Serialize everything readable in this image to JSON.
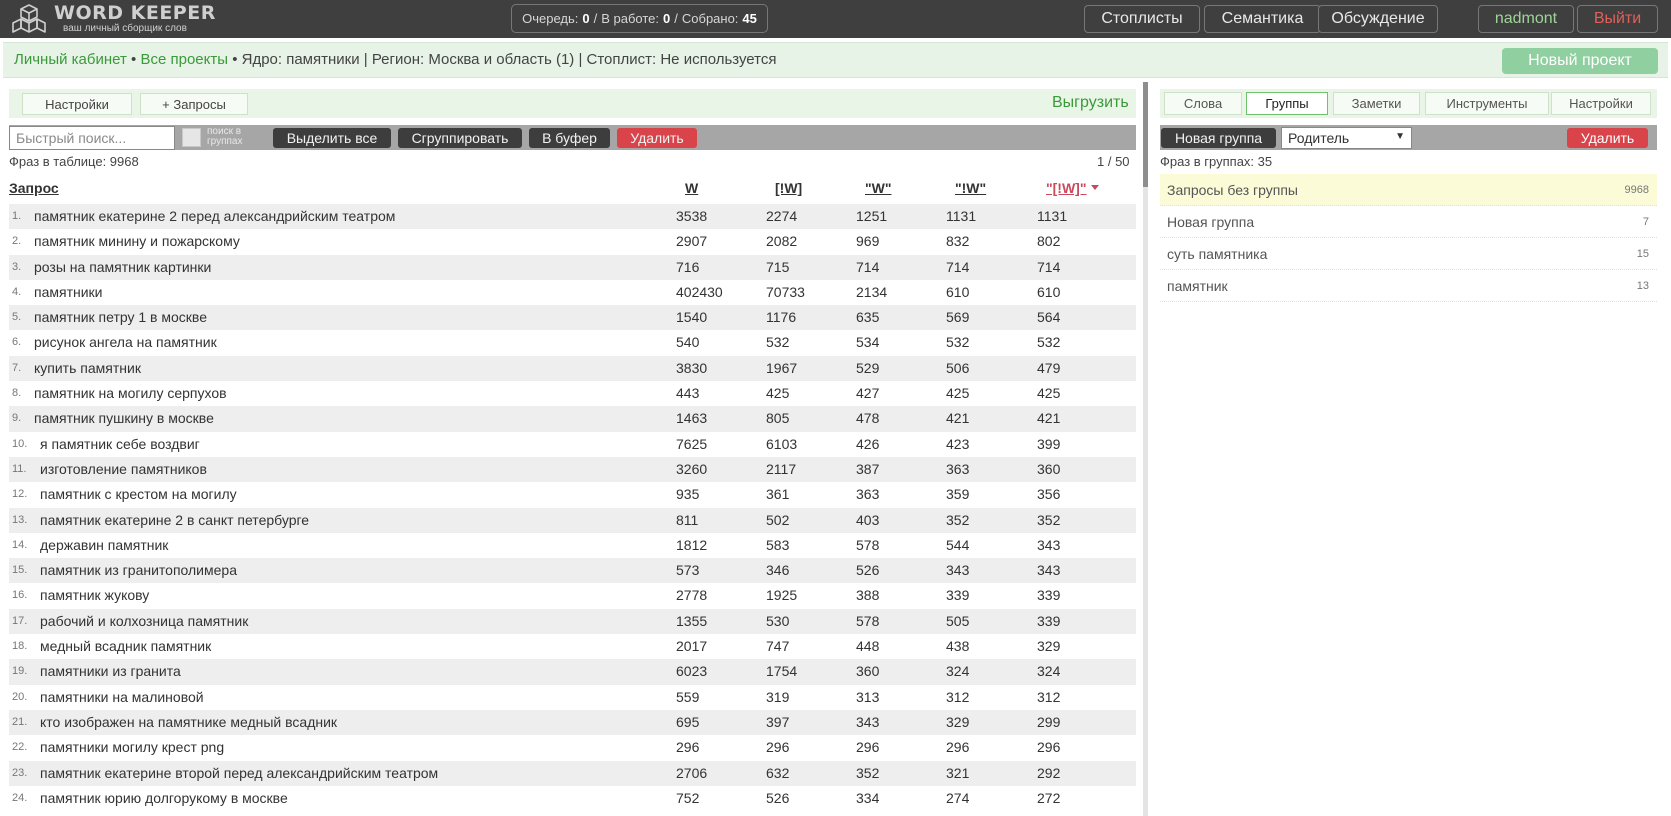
{
  "app": {
    "title": "WORD KEEPER",
    "subtitle": "ваш личный сборщик слов"
  },
  "queue": {
    "queue_label": "Очередь:",
    "queue_value": "0",
    "sep1": "/",
    "work_label": "В работе:",
    "work_value": "0",
    "sep2": "/",
    "collected_label": "Собрано:",
    "collected_value": "45"
  },
  "nav": {
    "stoplists": "Стоплисты",
    "semantics": "Семантика",
    "discussion": "Обсуждение",
    "user": "nadmont",
    "logout": "Выйти"
  },
  "breadcrumb": {
    "cabinet": "Личный кабинет",
    "dot1": "•",
    "projects": "Все проекты",
    "rest": "• Ядро: памятники | Регион: Москва и область (1) | Стоплист: Не используется"
  },
  "new_project": "Новый проект",
  "left": {
    "settings": "Настройки",
    "add_queries": "+ Запросы",
    "export": "Выгрузить",
    "search_placeholder": "Быстрый поиск...",
    "search_in_groups": "поиск в группах",
    "select_all": "Выделить все",
    "group": "Сгруппировать",
    "to_buffer": "В буфер",
    "delete": "Удалить",
    "phrase_count": "Фраз в таблице: 9968",
    "pager": "1 / 50",
    "columns": [
      "Запрос",
      "W",
      "[!W]",
      "\"W\"",
      "\"!W\"",
      "\"[!W]\""
    ],
    "rows": [
      {
        "n": "1.",
        "q": "памятник екатерине 2 перед александрийским театром",
        "v": [
          "3538",
          "2274",
          "1251",
          "1131",
          "1131"
        ]
      },
      {
        "n": "2.",
        "q": "памятник минину и пожарскому",
        "v": [
          "2907",
          "2082",
          "969",
          "832",
          "802"
        ]
      },
      {
        "n": "3.",
        "q": "розы на памятник картинки",
        "v": [
          "716",
          "715",
          "714",
          "714",
          "714"
        ]
      },
      {
        "n": "4.",
        "q": "памятники",
        "v": [
          "402430",
          "70733",
          "2134",
          "610",
          "610"
        ]
      },
      {
        "n": "5.",
        "q": "памятник петру 1 в москве",
        "v": [
          "1540",
          "1176",
          "635",
          "569",
          "564"
        ]
      },
      {
        "n": "6.",
        "q": "рисунок ангела на памятник",
        "v": [
          "540",
          "532",
          "534",
          "532",
          "532"
        ]
      },
      {
        "n": "7.",
        "q": "купить памятник",
        "v": [
          "3830",
          "1967",
          "529",
          "506",
          "479"
        ]
      },
      {
        "n": "8.",
        "q": "памятник на могилу серпухов",
        "v": [
          "443",
          "425",
          "427",
          "425",
          "425"
        ]
      },
      {
        "n": "9.",
        "q": "памятник пушкину в москве",
        "v": [
          "1463",
          "805",
          "478",
          "421",
          "421"
        ]
      },
      {
        "n": "10.",
        "q": "я памятник себе воздвиг",
        "v": [
          "7625",
          "6103",
          "426",
          "423",
          "399"
        ]
      },
      {
        "n": "11.",
        "q": "изготовление памятников",
        "v": [
          "3260",
          "2117",
          "387",
          "363",
          "360"
        ]
      },
      {
        "n": "12.",
        "q": "памятник с крестом на могилу",
        "v": [
          "935",
          "361",
          "363",
          "359",
          "356"
        ]
      },
      {
        "n": "13.",
        "q": "памятник екатерине 2 в санкт петербурге",
        "v": [
          "811",
          "502",
          "403",
          "352",
          "352"
        ]
      },
      {
        "n": "14.",
        "q": "державин памятник",
        "v": [
          "1812",
          "583",
          "578",
          "544",
          "343"
        ]
      },
      {
        "n": "15.",
        "q": "памятник из гранитополимера",
        "v": [
          "573",
          "346",
          "526",
          "343",
          "343"
        ]
      },
      {
        "n": "16.",
        "q": "памятник жукову",
        "v": [
          "2778",
          "1925",
          "388",
          "339",
          "339"
        ]
      },
      {
        "n": "17.",
        "q": "рабочий и колхозница памятник",
        "v": [
          "1355",
          "530",
          "578",
          "505",
          "339"
        ]
      },
      {
        "n": "18.",
        "q": "медный всадник памятник",
        "v": [
          "2017",
          "747",
          "448",
          "438",
          "329"
        ]
      },
      {
        "n": "19.",
        "q": "памятники из гранита",
        "v": [
          "6023",
          "1754",
          "360",
          "324",
          "324"
        ]
      },
      {
        "n": "20.",
        "q": "памятники на малиновой",
        "v": [
          "559",
          "319",
          "313",
          "312",
          "312"
        ]
      },
      {
        "n": "21.",
        "q": "кто изображен на памятнике медный всадник",
        "v": [
          "695",
          "397",
          "343",
          "329",
          "299"
        ]
      },
      {
        "n": "22.",
        "q": "памятники могилу крест png",
        "v": [
          "296",
          "296",
          "296",
          "296",
          "296"
        ]
      },
      {
        "n": "23.",
        "q": "памятник екатерине второй перед александрийским театром",
        "v": [
          "2706",
          "632",
          "352",
          "321",
          "292"
        ]
      },
      {
        "n": "24.",
        "q": "памятник юрию долгорукому в москве",
        "v": [
          "752",
          "526",
          "334",
          "274",
          "272"
        ]
      }
    ]
  },
  "right": {
    "tabs": [
      "Слова",
      "Группы",
      "Заметки",
      "Инструменты",
      "Настройки"
    ],
    "active_tab": "Группы",
    "new_group": "Новая группа",
    "parent": "Родитель",
    "delete": "Удалить",
    "phrase_count": "Фраз в группах: 35",
    "groups": [
      {
        "name": "Запросы без группы",
        "count": "9968"
      },
      {
        "name": "Новая группа",
        "count": "7"
      },
      {
        "name": "суть памятника",
        "count": "15"
      },
      {
        "name": "памятник",
        "count": "13"
      }
    ]
  },
  "colors": {
    "topbar": "#3f3f3f",
    "accent_green": "#3a9a3a",
    "danger": "#d9444a",
    "sorted_column": "#c84a5c"
  }
}
